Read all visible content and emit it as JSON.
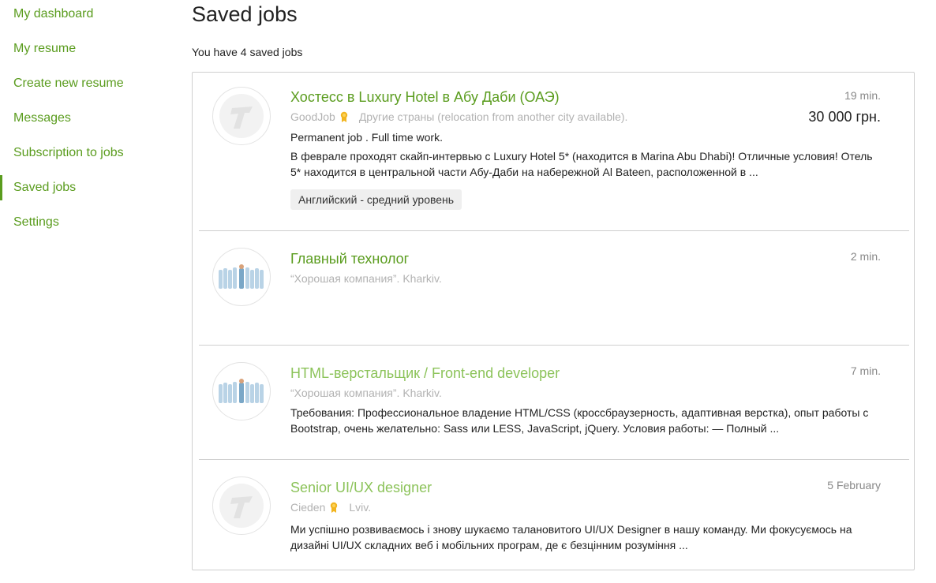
{
  "sidebar": {
    "items": [
      {
        "label": "My dashboard"
      },
      {
        "label": "My resume"
      },
      {
        "label": "Create new resume"
      },
      {
        "label": "Messages"
      },
      {
        "label": "Subscription to jobs"
      },
      {
        "label": "Saved jobs",
        "active": true
      },
      {
        "label": "Settings"
      }
    ]
  },
  "main": {
    "title": "Saved jobs",
    "saved_count_text": "You have 4 saved jobs"
  },
  "jobs": [
    {
      "title": "Хостесс в Luxury Hotel в Абу Даби (ОАЭ)",
      "company": "GoodJob",
      "location": "Другие страны (relocation from another city available).",
      "employment": "Permanent job . Full time work.",
      "description": "В феврале проходят скайп-интервью с Luxury Hotel 5* (находится в Marina Abu Dhabi)! Отличные условия! Отель 5* находится в центральной части Абу-Даби на набережной Al Bateen, расположенной в ...",
      "tag": "Английский - средний уровень",
      "time": "19 min.",
      "salary": "30 000 грн.",
      "logo_icon": "company-logo-icon"
    },
    {
      "title": "Главный технолог",
      "company": "",
      "location": "“Хорошая компания”. Kharkiv.",
      "time": "2 min.",
      "logo_icon": "people-crowd-icon"
    },
    {
      "title": "HTML-верстальщик / Front-end developer",
      "location": "“Хорошая компания”. Kharkiv.",
      "description": "Требования: Профессиональное владение HTML/CSS (кроссбраузерность, адаптивная верстка), опыт работы с Bootstrap, очень желательно: Sass или LESS, JavaScript, jQuery. Условия работы: — Полный ...",
      "time": "7 min.",
      "logo_icon": "people-crowd-icon"
    },
    {
      "title": "Senior UI/UX designer",
      "company": "Cieden",
      "location": "Lviv.",
      "description": "Ми успішно розвиваємось і знову шукаємо талановитого UI/UX Designer в нашу команду. Ми фокусуємось на дизайні UI/UX складних веб і мобільних програм, де є безцінним розуміння ...",
      "time": "5 February",
      "logo_icon": "company-logo-icon"
    }
  ],
  "colors": {
    "accent": "#5a9c1e",
    "visited_link": "#8cc35a",
    "muted": "#b2b2b2",
    "border": "#cfcfcf",
    "medal": "#f2b520"
  }
}
